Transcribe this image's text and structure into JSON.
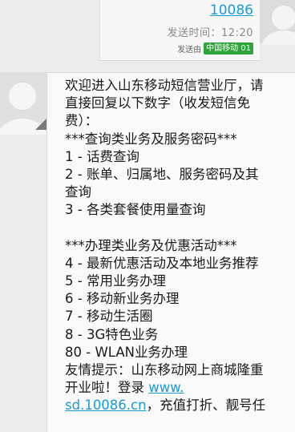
{
  "sent": {
    "number": "10086",
    "time": "发送时间：12:20",
    "via_label": "发送由",
    "sim_label": "中国移动 01"
  },
  "message": {
    "intro": [
      "欢迎进入山东移动短信营业厅，请",
      "直接回复以下数字（收发短信免",
      "费）："
    ],
    "query_header": "***查询类业务及服务密码***",
    "query_items": [
      "1 - 话费查询",
      "2 - 账单、归属地、服务密码及其",
      "查询",
      "3 - 各类套餐使用量查询"
    ],
    "handle_header": "***办理类业务及优惠活动***",
    "handle_items": [
      "4 - 最新优惠活动及本地业务推荐",
      "5 - 常用业务办理",
      "6 - 移动新业务办理",
      "7 - 移动生活圈",
      "8 - 3G特色业务",
      "80 - WLAN业务办理"
    ],
    "tip_line1": "友情提示：山东移动网上商城隆重",
    "tip_line2_text": "开业啦！登录 ",
    "tip_link1": "www.",
    "tip_link2": "sd.10086.cn",
    "tip_line3_text": "，充值打折、靓号任"
  }
}
